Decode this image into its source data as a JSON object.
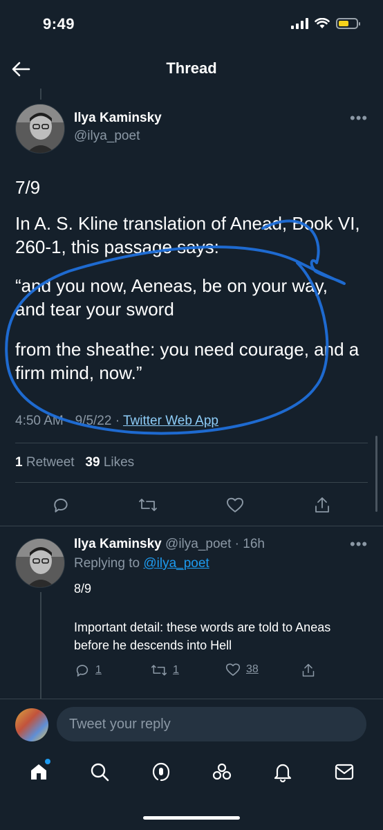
{
  "status_bar": {
    "time": "9:49"
  },
  "header": {
    "title": "Thread"
  },
  "main_tweet": {
    "author_name": "Ilya Kaminsky",
    "author_handle": "@ilya_poet",
    "lines": [
      "7/9",
      "In A. S. Kline translation of Anead, Book VI, 260-1, this passage says:",
      "“and you now, Aeneas, be on your way, and tear your sword",
      "from the sheathe: you need courage, and a firm mind, now.”"
    ],
    "time": "4:50 AM",
    "date": "9/5/22",
    "via": "Twitter Web App",
    "retweet_count": "1",
    "retweet_label": "Retweet",
    "like_count": "39",
    "like_label": "Likes"
  },
  "reply_tweet": {
    "author_name": "Ilya Kaminsky",
    "author_handle": "@ilya_poet",
    "age": "16h",
    "replying_label": "Replying to",
    "replying_to": "@ilya_poet",
    "lines": [
      "8/9",
      "Important detail: these words are told to Aneas before he descends into Hell"
    ],
    "reply_count": "1",
    "retweet_count": "1",
    "like_count": "38"
  },
  "composer": {
    "placeholder": "Tweet your reply"
  },
  "colors": {
    "background": "#15202b",
    "accent": "#1d9bf0",
    "secondary_text": "#8b98a5",
    "annotation": "#1f6fd9"
  },
  "icons": [
    "back-arrow-icon",
    "more-icon",
    "reply-icon",
    "retweet-icon",
    "like-icon",
    "share-icon",
    "home-icon",
    "search-icon",
    "spaces-icon",
    "communities-icon",
    "notifications-icon",
    "messages-icon"
  ]
}
